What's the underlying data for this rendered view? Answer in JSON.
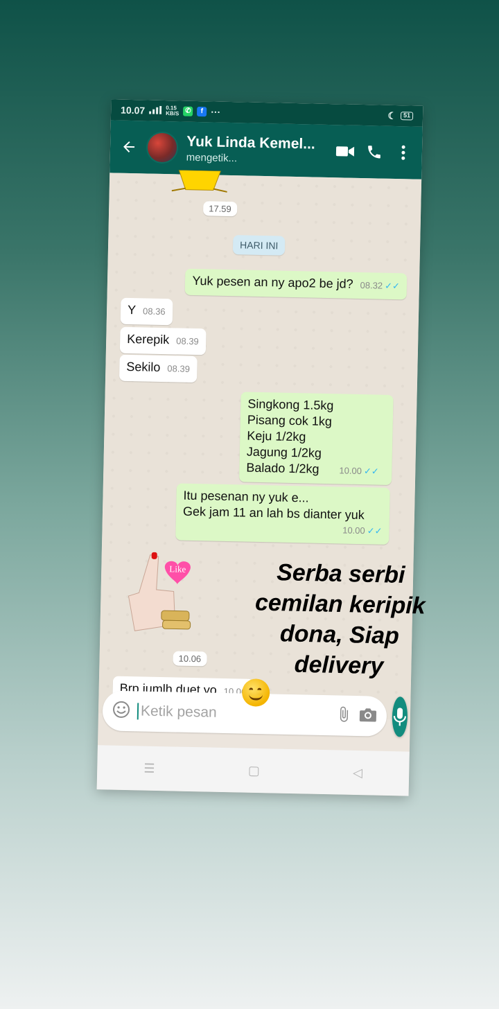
{
  "status_bar": {
    "time": "10.07",
    "network": "0.15\nKB/S",
    "battery": "51",
    "more": "···"
  },
  "header": {
    "contact_name": "Yuk Linda Kemel...",
    "status": "mengetik..."
  },
  "chat": {
    "top_sticker_time": "17.59",
    "day_label": "HARI INI",
    "messages": [
      {
        "dir": "out",
        "text": "Yuk pesen an ny apo2 be jd?",
        "time": "08.32",
        "ticks": "✓✓"
      },
      {
        "dir": "in",
        "text": "Y",
        "time": "08.36"
      },
      {
        "dir": "in",
        "text": "Kerepik",
        "time": "08.39"
      },
      {
        "dir": "in",
        "text": "Sekilo",
        "time": "08.39"
      },
      {
        "dir": "out",
        "lines": [
          "Singkong 1.5kg",
          "Pisang cok 1kg",
          "Keju 1/2kg",
          "Jagung 1/2kg",
          "Balado 1/2kg"
        ],
        "time": "10.00",
        "ticks": "✓✓"
      },
      {
        "dir": "out",
        "lines": [
          "Itu pesenan ny yuk e...",
          "Gek jam 11 an lah bs dianter yuk"
        ],
        "time": "10.00",
        "ticks": "✓✓"
      },
      {
        "dir": "in",
        "text": "Brp jumlh duet yo",
        "time": "10.06"
      }
    ],
    "like_sticker_label": "Like",
    "like_sticker_time": "10.06"
  },
  "input": {
    "placeholder": "Ketik pesan"
  },
  "overlay": {
    "lines": [
      "Serba serbi",
      "cemilan keripik",
      "dona, Siap",
      "delivery"
    ]
  },
  "colors": {
    "header": "#075e54",
    "status_bar": "#064b40",
    "outgoing_bubble": "#dcf8c6",
    "incoming_bubble": "#ffffff",
    "accent": "#128c7e",
    "read_ticks": "#34b7f1"
  },
  "icons": [
    "back-arrow-icon",
    "video-call-icon",
    "phone-icon",
    "more-vert-icon",
    "emoji-icon",
    "attach-icon",
    "camera-icon",
    "mic-icon",
    "nav-menu-icon",
    "nav-home-icon",
    "nav-back-icon",
    "smiling-hug-emoji"
  ]
}
